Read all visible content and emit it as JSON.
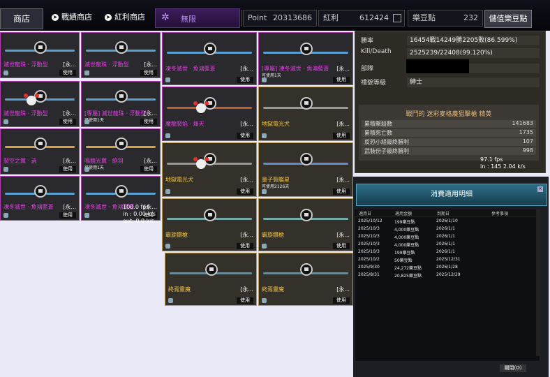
{
  "topbar": {
    "shop": "商店",
    "nav1": "戰績商店",
    "nav2": "紅利商店",
    "vip_label": "無限",
    "point_label": "Point",
    "point_value": "20313686",
    "bonus_label": "紅利",
    "bonus_value": "612424",
    "bean_label": "樂豆點",
    "bean_value": "232",
    "charge_label": "儲值樂豆點"
  },
  "cards": [
    {
      "name": "滅世龍珠 · 浮動型",
      "tag": "[永...",
      "use": "使用",
      "sub": ""
    },
    {
      "name": "滅世龍珠 · 浮動型",
      "tag": "[永...",
      "use": "使用",
      "sub": ""
    },
    {
      "name": "滅世龍珠 · 浮動型",
      "tag": "[永...",
      "use": "使用",
      "sub": ""
    },
    {
      "name": "[專屬] 滅世龍珠 · 浮動型",
      "tag": "[永...",
      "use": "使用",
      "sub": "可使用1天"
    },
    {
      "name": "裂空之翼 · 過",
      "tag": "[永...",
      "use": "使用",
      "sub": ""
    },
    {
      "name": "鳴鏡光翼 · 絕羽",
      "tag": "[永...",
      "use": "使用",
      "sub": "可使用1天"
    },
    {
      "name": "凍冬滅世 · 魚鴻藍蒼",
      "tag": "[永...",
      "use": "使用",
      "sub": ""
    },
    {
      "name": "凍冬滅世 · 魚鴻藍蒼",
      "tag": "[永...",
      "use": "使用",
      "sub": ""
    },
    {
      "name": "凍冬滅世 · 魚鴻藍蒼",
      "tag": "[永...",
      "use": "使用",
      "sub": ""
    },
    {
      "name": "[專屬] 凍冬滅世 · 魚鴻藍蒼",
      "tag": "[永...",
      "use": "使用",
      "sub": "可使用1天"
    },
    {
      "name": "魔龍裂焰 · 烽天",
      "tag": "[永...",
      "use": "使用",
      "sub": ""
    },
    {
      "name": "地獄電光犬",
      "tag": "[永...",
      "use": "使用",
      "sub": ""
    },
    {
      "name": "地獄電光犬",
      "tag": "[永...",
      "use": "使用",
      "sub": ""
    },
    {
      "name": "量子裂艦星",
      "tag": "[永...",
      "use": "使用",
      "sub": "可使用2126天"
    },
    {
      "name": "霸旋鑽槍",
      "tag": "[永...",
      "use": "使用",
      "sub": ""
    },
    {
      "name": "霸旋鑽槍",
      "tag": "[永...",
      "use": "使用",
      "sub": ""
    },
    {
      "name": "終焉靈魔",
      "tag": "[永...",
      "use": "使用",
      "sub": ""
    },
    {
      "name": "終焉靈魔",
      "tag": "[永...",
      "use": "使用",
      "sub": ""
    }
  ],
  "fps_overlay": {
    "line1": "100.0 fps",
    "line2": "in : 0.00 k/s",
    "line3": "out: 0.0 k/s"
  },
  "stats": {
    "win_label": "勝率",
    "win_value": "16454戰14249勝2205敗(86.599%)",
    "kd_label": "Kill/Death",
    "kd_value": "2525239/22408(99.120%)",
    "squad_label": "部隊",
    "rank_label": "禮貌等級",
    "rank_value": "紳士",
    "battle_title": "戰鬥的 迷彩麥格農狙擊槍 精英",
    "rows": [
      {
        "k": "累積擊殺數",
        "v": "141683"
      },
      {
        "k": "累積死亡數",
        "v": "1735"
      },
      {
        "k": "反恐小組最終勝利",
        "v": "107"
      },
      {
        "k": "武裝份子最終勝利",
        "v": "998"
      }
    ],
    "fps1": "97.1 fps",
    "fps2": "in : 145 2.04 k/s"
  },
  "panel": {
    "title": "消費適用明細",
    "cols": [
      "適用日",
      "適用金額",
      "到期日",
      "參考事項"
    ],
    "rows": [
      [
        "2025/10/12",
        "199樂豆點",
        "2026/1/10",
        ""
      ],
      [
        "2025/10/3",
        "4,000樂豆點",
        "2026/1/1",
        ""
      ],
      [
        "2025/10/3",
        "4,000樂豆點",
        "2026/1/1",
        ""
      ],
      [
        "2025/10/3",
        "4,000樂豆點",
        "2026/1/1",
        ""
      ],
      [
        "2025/10/3",
        "199樂豆點",
        "2026/1/1",
        ""
      ],
      [
        "2025/10/2",
        "50樂豆點",
        "2025/12/31",
        ""
      ],
      [
        "2025/9/30",
        "24,272樂豆點",
        "2026/1/28",
        ""
      ],
      [
        "2025/8/31",
        "20,825樂豆點",
        "2025/12/29",
        ""
      ]
    ],
    "close": "關閉(O)"
  }
}
